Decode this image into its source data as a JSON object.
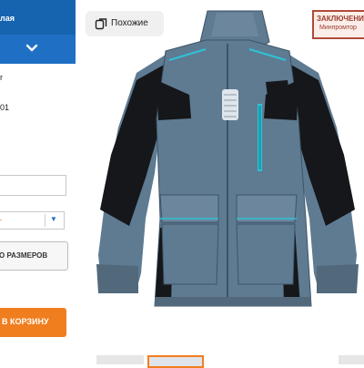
{
  "left_panel": {
    "header_fragment": "лая",
    "frag_1": "r",
    "frag_2": "01",
    "select_value": "-",
    "sizes_button_label": "О РАЗМЕРОВ",
    "cart_button_label": "В КОРЗИНУ"
  },
  "gallery": {
    "similar_label": "Похожие",
    "stamp_line1": "ЗАКЛЮЧЕНИ",
    "stamp_line2": "Минпромтор"
  },
  "colors": {
    "header_blue": "#1664b0",
    "accent_orange": "#f07e1f",
    "jacket_grey": "#5f7b92",
    "jacket_black": "#15171a",
    "jacket_cyan": "#2fc2d6"
  }
}
